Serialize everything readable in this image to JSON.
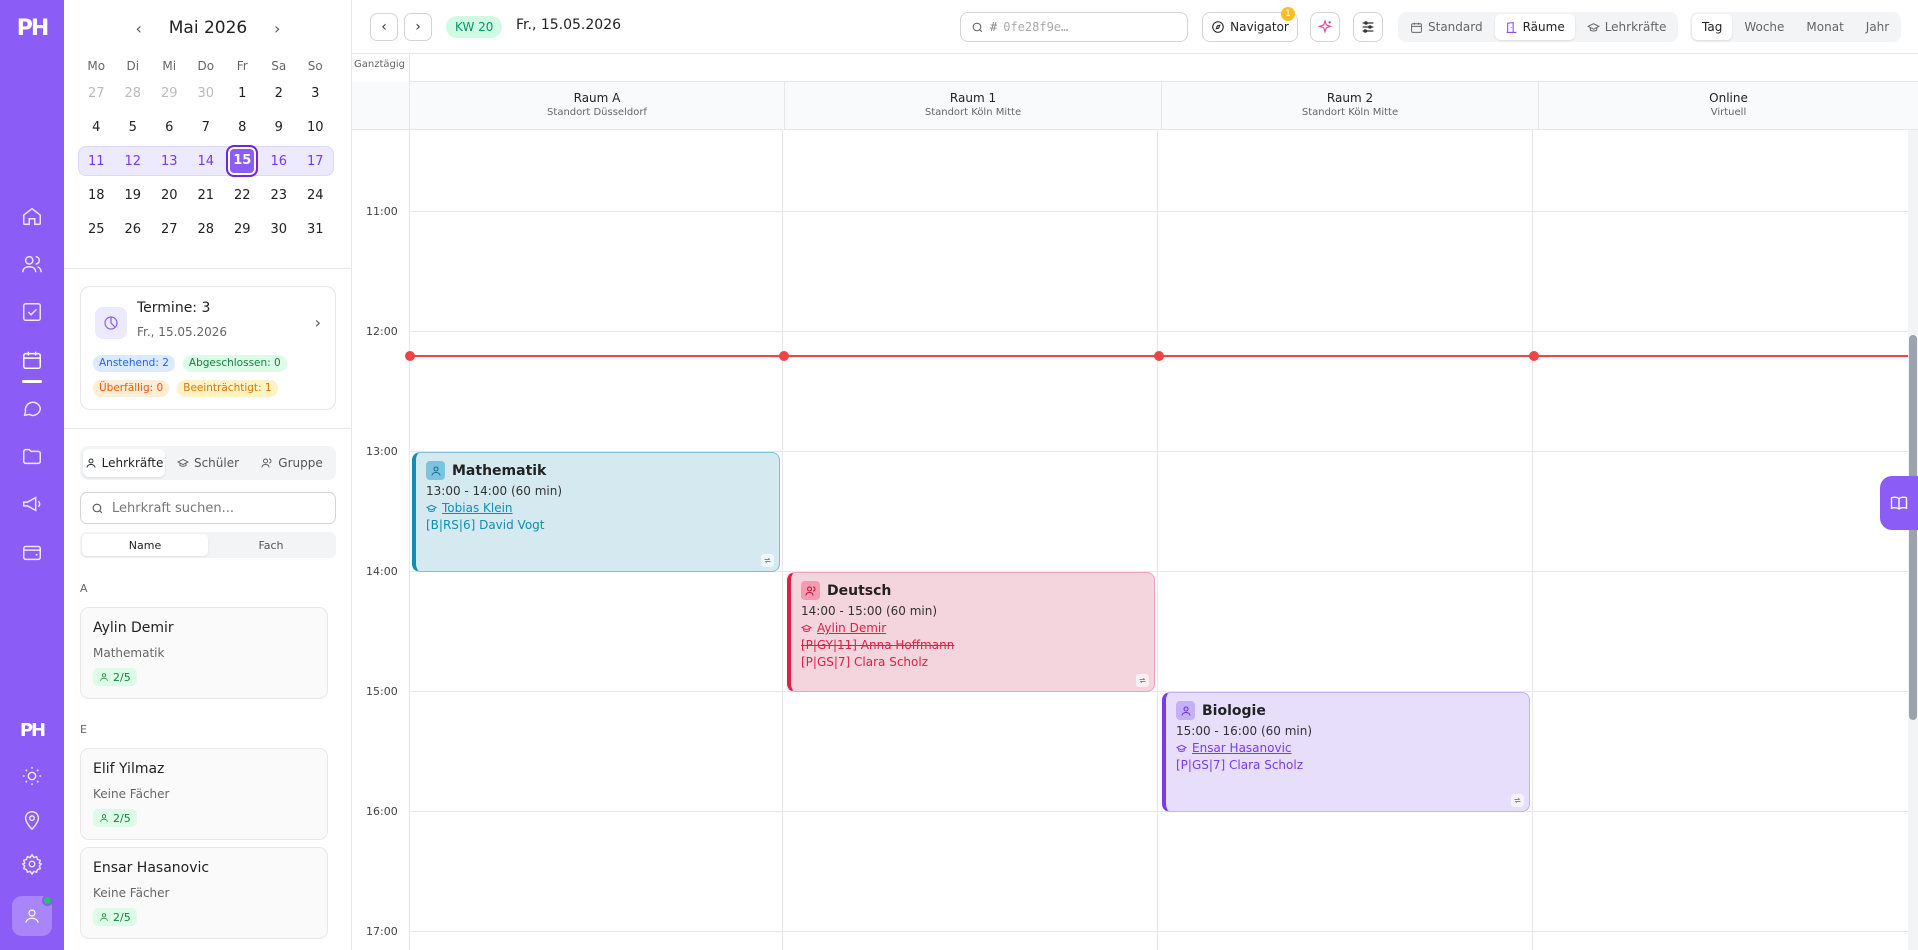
{
  "app": {
    "logo_text": "PH",
    "brand_color": "#8b5cf6"
  },
  "mini_calendar": {
    "month_label": "Mai 2026",
    "weekdays": [
      "Mo",
      "Di",
      "Mi",
      "Do",
      "Fr",
      "Sa",
      "So"
    ],
    "weeks": [
      [
        "27",
        "28",
        "29",
        "30",
        "1",
        "2",
        "3"
      ],
      [
        "4",
        "5",
        "6",
        "7",
        "8",
        "9",
        "10"
      ],
      [
        "11",
        "12",
        "13",
        "14",
        "15",
        "16",
        "17"
      ],
      [
        "18",
        "19",
        "20",
        "21",
        "22",
        "23",
        "24"
      ],
      [
        "25",
        "26",
        "27",
        "28",
        "29",
        "30",
        "31"
      ]
    ],
    "selected_day": "15"
  },
  "summary": {
    "title": "Termine: 3",
    "date": "Fr., 15.05.2026",
    "badges": {
      "upcoming": "Anstehend: 2",
      "done": "Abgeschlossen: 0",
      "overdue": "Überfällig: 0",
      "impaired": "Beeinträchtigt: 1"
    }
  },
  "people_tabs": {
    "teachers": "Lehrkräfte",
    "students": "Schüler",
    "groups": "Gruppe"
  },
  "teacher_search": {
    "placeholder": "Lehrkraft suchen..."
  },
  "sort": {
    "name": "Name",
    "subject": "Fach"
  },
  "teacher_list": {
    "group_a": "A",
    "group_e": "E",
    "t1": {
      "name": "Aylin Demir",
      "subject": "Mathematik",
      "capacity": "2/5"
    },
    "t2": {
      "name": "Elif Yilmaz",
      "subject": "Keine Fächer",
      "capacity": "2/5"
    },
    "t3": {
      "name": "Ensar Hasanovic",
      "subject": "Keine Fächer",
      "capacity": "2/5"
    }
  },
  "toolbar": {
    "week_badge": "KW 20",
    "date_label": "Fr., 15.05.2026",
    "id_search_hash": "#",
    "id_search_placeholder": "0fe28f9e…",
    "navigator_label": "Navigator",
    "navigator_count": "1",
    "views": {
      "standard": "Standard",
      "rooms": "Räume",
      "teachers": "Lehrkräfte"
    },
    "ranges": {
      "day": "Tag",
      "week": "Woche",
      "month": "Monat",
      "year": "Jahr"
    }
  },
  "calendar": {
    "allday_label": "Ganztägig",
    "rooms": [
      {
        "name": "Raum A",
        "sub": "Standort Düsseldorf"
      },
      {
        "name": "Raum 1",
        "sub": "Standort Köln Mitte"
      },
      {
        "name": "Raum 2",
        "sub": "Standort Köln Mitte"
      },
      {
        "name": "Online",
        "sub": "Virtuell"
      }
    ],
    "hours": [
      "11:00",
      "12:00",
      "13:00",
      "14:00",
      "15:00",
      "16:00",
      "17:00"
    ],
    "events": {
      "math": {
        "title": "Mathematik",
        "time": "13:00 - 14:00 (60 min)",
        "teacher": "Tobias Klein",
        "student": "[B|RS|6] David Vogt",
        "color": "#0e8fb3"
      },
      "deutsch": {
        "title": "Deutsch",
        "time": "14:00 - 15:00 (60 min)",
        "teacher": "Aylin Demir",
        "student_cancelled": "[P|GY|11] Anna Hoffmann",
        "student": "[P|GS|7] Clara Scholz",
        "color": "#e11d48"
      },
      "bio": {
        "title": "Biologie",
        "time": "15:00 - 16:00 (60 min)",
        "teacher": "Ensar Hasanovic",
        "student": "[P|GS|7] Clara Scholz",
        "color": "#7c3aed"
      }
    }
  }
}
